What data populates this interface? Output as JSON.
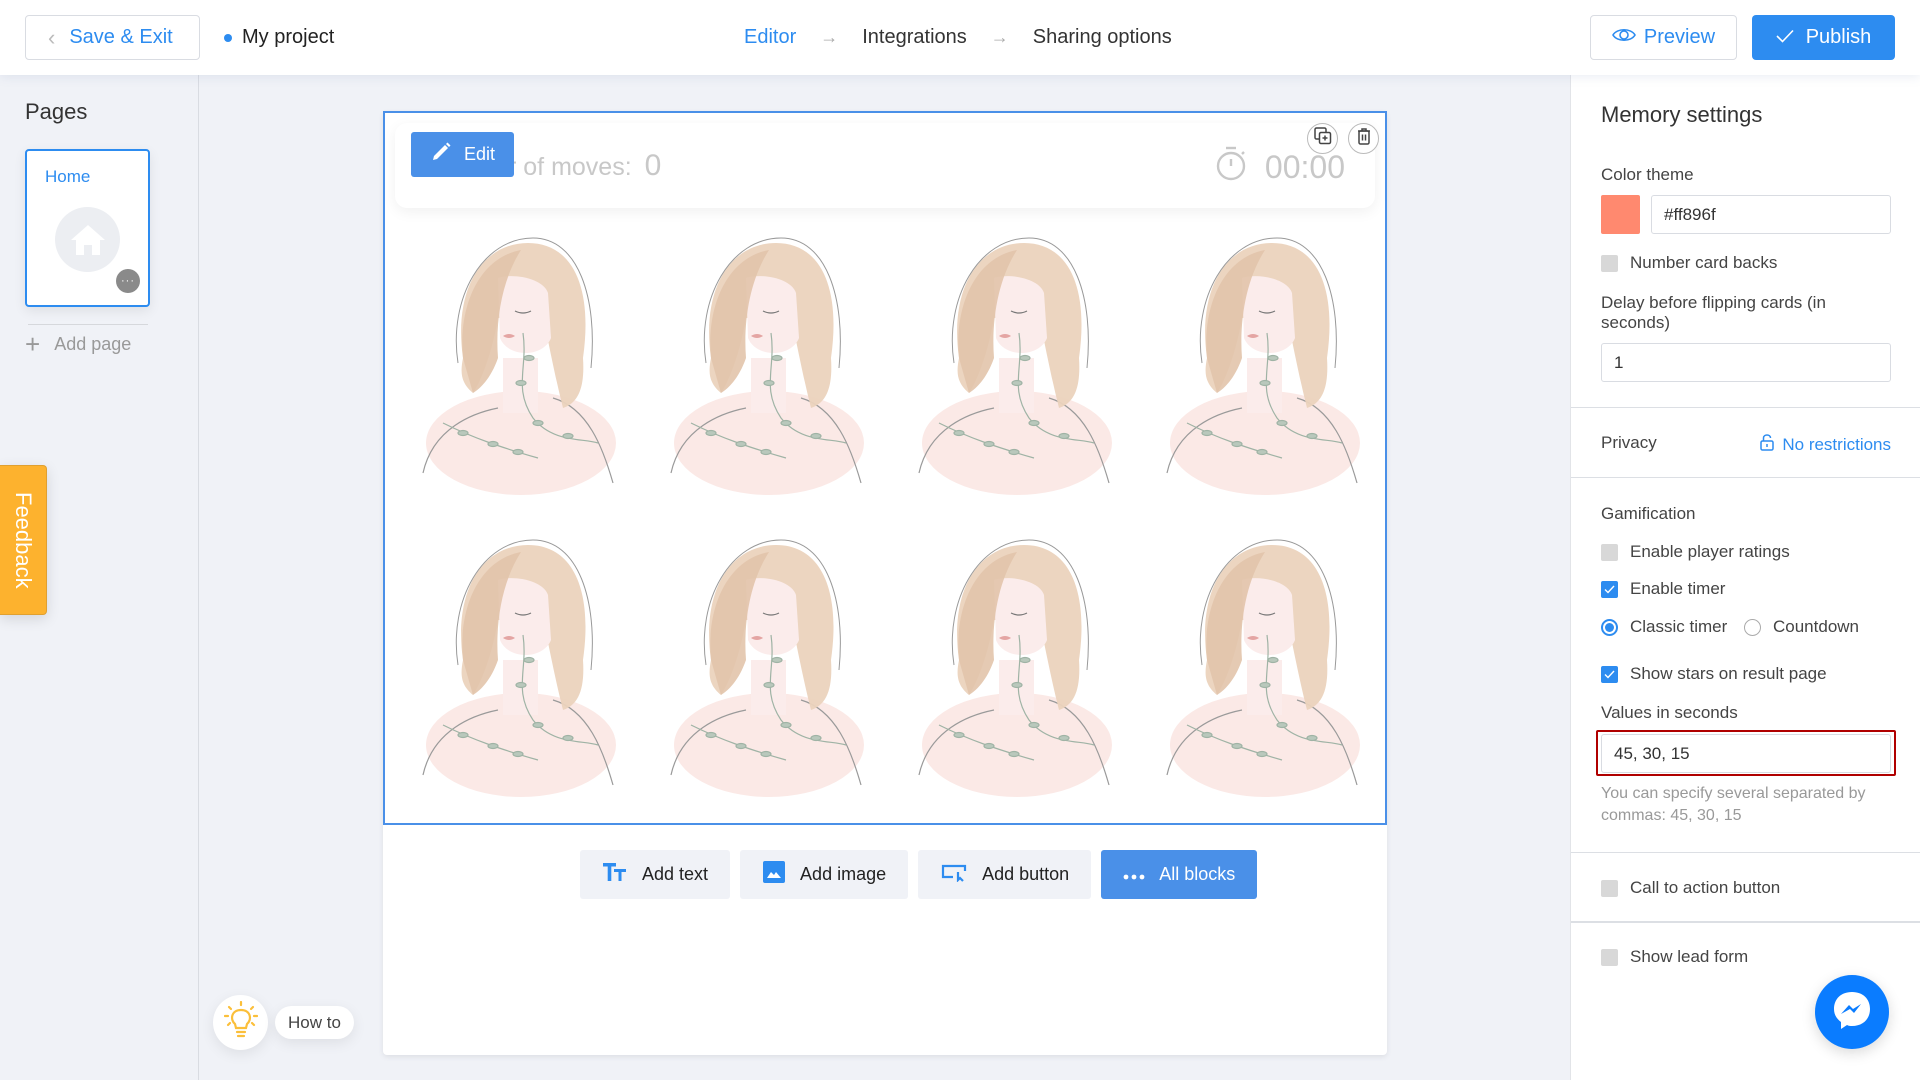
{
  "header": {
    "save_exit_label": "Save & Exit",
    "project_name": "My project",
    "steps": [
      {
        "label": "Editor",
        "active": true
      },
      {
        "label": "Integrations",
        "active": false
      },
      {
        "label": "Sharing options",
        "active": false
      }
    ],
    "step_arrow": "→",
    "preview_label": "Preview",
    "publish_label": "Publish"
  },
  "sidebar": {
    "title": "Pages",
    "pages": [
      {
        "label": "Home",
        "icon": "home-icon"
      }
    ],
    "more_label": "···",
    "add_page_label": "Add page"
  },
  "feedback_label": "Feedback",
  "howto_label": "How to",
  "canvas": {
    "edit_label": "Edit",
    "moves_label": "r of moves:",
    "moves_value": "0",
    "timer_value": "00:00",
    "card_count": 8,
    "add_blocks": [
      {
        "label": "Add text",
        "icon": "text-icon"
      },
      {
        "label": "Add image",
        "icon": "image-icon"
      },
      {
        "label": "Add button",
        "icon": "button-icon"
      },
      {
        "label": "All blocks",
        "icon": "more-dots-icon"
      }
    ]
  },
  "panel": {
    "title": "Memory settings",
    "color_theme_label": "Color theme",
    "color_theme_value": "#ff896f",
    "number_card_backs_label": "Number card backs",
    "number_card_backs_checked": false,
    "delay_label": "Delay before flipping cards (in seconds)",
    "delay_value": "1",
    "privacy_label": "Privacy",
    "privacy_value": "No restrictions",
    "gamification_label": "Gamification",
    "enable_player_ratings_label": "Enable player ratings",
    "enable_player_ratings_checked": false,
    "enable_timer_label": "Enable timer",
    "enable_timer_checked": true,
    "timer_modes": [
      {
        "label": "Classic timer",
        "selected": true
      },
      {
        "label": "Countdown",
        "selected": false
      }
    ],
    "show_stars_label": "Show stars on result page",
    "show_stars_checked": true,
    "values_label": "Values in seconds",
    "values_value": "45, 30, 15",
    "values_hint": "You can specify several separated by commas: 45, 30, 15",
    "cta_label": "Call to action button",
    "cta_checked": false,
    "lead_form_label": "Show lead form",
    "lead_form_checked": false
  },
  "colors": {
    "accent": "#2d8cf0",
    "theme": "#ff896f",
    "feedback": "#fdb22e",
    "highlight": "#b00000"
  }
}
